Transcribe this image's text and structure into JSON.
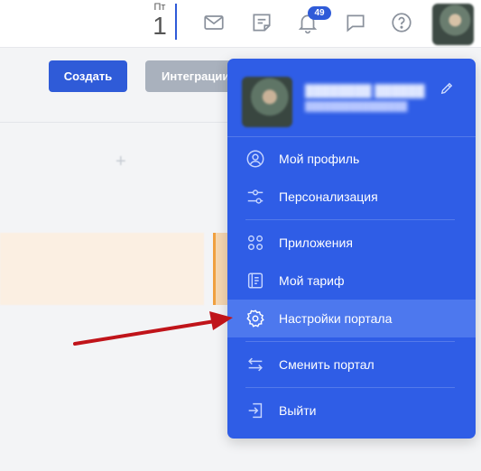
{
  "topbar": {
    "day_of_week": "Пт",
    "day_number": "1",
    "notifications_count": "49",
    "icons": [
      "mail-icon",
      "notes-icon",
      "bell-icon",
      "chat-icon",
      "help-icon"
    ]
  },
  "toolbar": {
    "create_label": "Создать",
    "integrations_label": "Интеграции"
  },
  "menu": {
    "items": [
      {
        "label": "Мой профиль",
        "icon": "profile-icon"
      },
      {
        "label": "Персонализация",
        "icon": "sliders-icon"
      },
      {
        "label": "Приложения",
        "icon": "apps-icon"
      },
      {
        "label": "Мой тариф",
        "icon": "tariff-icon"
      },
      {
        "label": "Настройки портала",
        "icon": "gear-icon"
      },
      {
        "label": "Сменить портал",
        "icon": "swap-icon"
      },
      {
        "label": "Выйти",
        "icon": "logout-icon"
      }
    ]
  },
  "colors": {
    "menu_bg": "#2f5de6",
    "menu_active_bg": "#4d78ee",
    "primary_button": "#2f5bd8",
    "secondary_button": "#a9b1bd",
    "annotation_arrow": "#c0141a"
  }
}
